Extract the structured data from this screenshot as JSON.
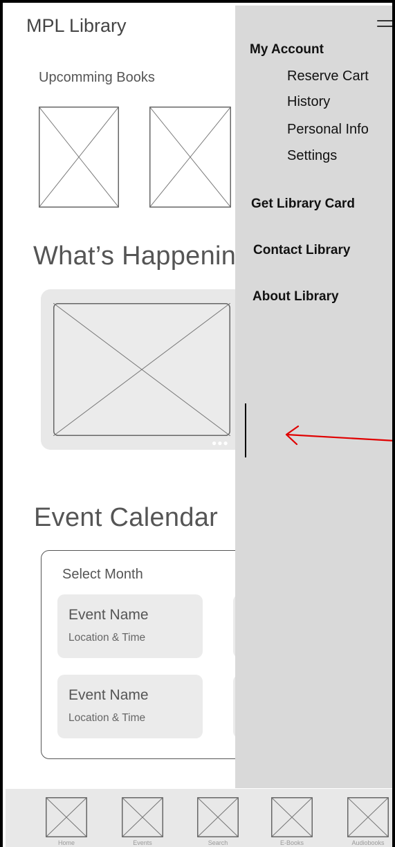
{
  "app": {
    "title": "MPL Library"
  },
  "main": {
    "upcoming_label": "Upcomming Books",
    "whats_happening": "What’s Happening",
    "event_calendar": "Event Calendar",
    "select_month": "Select Month",
    "events": [
      {
        "name": "Event Name",
        "detail": "Location & Time"
      },
      {
        "name": "Event Name",
        "detail": "Location & Time"
      }
    ]
  },
  "drawer": {
    "menu_icon": "hamburger-menu-icon",
    "my_account": "My Account",
    "account_items": [
      "Reserve Cart",
      "History",
      "Personal Info",
      "Settings"
    ],
    "get_library_card": "Get Library Card",
    "contact_library": "Contact Library",
    "about_library": "About Library"
  },
  "annotation": {
    "arrow_color": "#e00000",
    "arrow_icon": "left-arrow-icon"
  },
  "bottom_nav": {
    "items": [
      {
        "label": "Home",
        "icon": "image-placeholder-icon"
      },
      {
        "label": "Events",
        "icon": "image-placeholder-icon"
      },
      {
        "label": "Search",
        "icon": "image-placeholder-icon"
      },
      {
        "label": "E-Books",
        "icon": "image-placeholder-icon"
      },
      {
        "label": "Audiobooks",
        "icon": "image-placeholder-icon"
      }
    ]
  },
  "colors": {
    "drawer_bg": "#d9d9d9",
    "card_bg": "#e8e8e8",
    "frame": "#000000"
  }
}
